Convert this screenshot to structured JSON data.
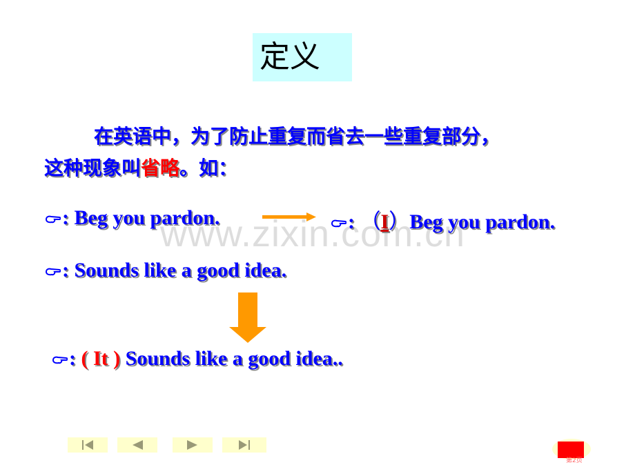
{
  "slide": {
    "title": "定义",
    "paragraph": {
      "line1": "在英语中，为了防止重复而省去一些重复部分，",
      "line2_prefix": "这种现象叫",
      "line2_highlight": "省略",
      "line2_suffix": "。如："
    },
    "examples": [
      {
        "bullet": "pointing-hand",
        "colon": ":",
        "text": "Beg you pardon."
      },
      {
        "bullet": "pointing-hand",
        "colon": ":",
        "open_paren": "（",
        "inserted": "I",
        "close_paren": "）",
        "text": "Beg you pardon."
      },
      {
        "bullet": "pointing-hand",
        "colon": ":",
        "text": "Sounds like a good idea."
      },
      {
        "bullet": "pointing-hand",
        "colon": ":",
        "inserted": "( It )",
        "text": "Sounds like a good idea.."
      }
    ],
    "watermark": "www.zixin.com.cn"
  },
  "navigation": {
    "buttons": [
      {
        "name": "first",
        "icon": "first-slide-icon"
      },
      {
        "name": "previous",
        "icon": "previous-slide-icon"
      },
      {
        "name": "next",
        "icon": "next-slide-icon"
      },
      {
        "name": "last",
        "icon": "last-slide-icon"
      }
    ],
    "page_label": "第2页"
  },
  "colors": {
    "text_blue": "#0000ff",
    "highlight_red": "#ff0000",
    "arrow_orange": "#ff9900",
    "title_bg": "#ccffff",
    "nav_bg": "#ffffcc",
    "nav_icon": "#999977"
  }
}
